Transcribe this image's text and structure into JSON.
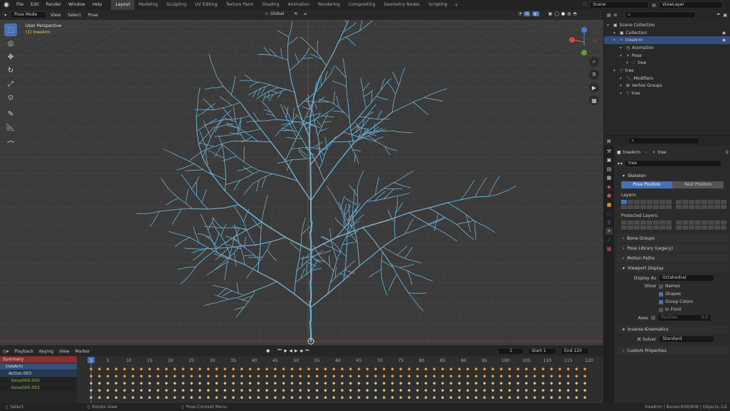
{
  "topbar": {
    "menu": [
      "File",
      "Edit",
      "Render",
      "Window",
      "Help"
    ],
    "workspaces": [
      "Layout",
      "Modeling",
      "Sculpting",
      "UV Editing",
      "Texture Paint",
      "Shading",
      "Animation",
      "Rendering",
      "Compositing",
      "Geometry Nodes",
      "Scripting"
    ],
    "active_workspace": "Layout",
    "scene": "Scene",
    "view_layer": "ViewLayer"
  },
  "viewport": {
    "mode": "Pose Mode",
    "menus": [
      "View",
      "Select",
      "Pose"
    ],
    "orientation": "Global",
    "perspective": "User Perspective",
    "object": "(1) treeArm"
  },
  "outliner": {
    "rows": [
      {
        "label": "Scene Collection",
        "indent": 0,
        "icon": "collection-icon"
      },
      {
        "label": "Collection",
        "indent": 1,
        "icon": "collection-icon"
      },
      {
        "label": "treeArm",
        "indent": 1,
        "icon": "armature-icon",
        "selected": true
      },
      {
        "label": "Animation",
        "indent": 2,
        "icon": "animation-icon"
      },
      {
        "label": "Pose",
        "indent": 2,
        "icon": "pose-icon"
      },
      {
        "label": "tree",
        "indent": 3,
        "icon": "bone-icon"
      },
      {
        "label": "tree",
        "indent": 1,
        "icon": "mesh-icon"
      },
      {
        "label": "Modifiers",
        "indent": 2,
        "icon": "wrench-icon"
      },
      {
        "label": "Vertex Groups",
        "indent": 2,
        "icon": "vertex-group-icon"
      },
      {
        "label": "tree",
        "indent": 2,
        "icon": "mesh-data-icon"
      }
    ]
  },
  "properties": {
    "breadcrumb_object": "treeArm",
    "breadcrumb_data": "tree",
    "data_name": "tree",
    "skeleton": "Skeleton",
    "pose_position": "Pose Position",
    "rest_position": "Rest Position",
    "layers": "Layers:",
    "protected_layers": "Protected Layers:",
    "bone_groups": "Bone Groups",
    "pose_library": "Pose Library (Legacy)",
    "motion_paths": "Motion Paths",
    "viewport_display": "Viewport Display",
    "display_as_label": "Display As",
    "display_as": "Octahedral",
    "show_label": "Show",
    "names": "Names",
    "shapes": "Shapes",
    "group_colors": "Group Colors",
    "in_front": "In Front",
    "axes": "Axes",
    "axes_position": "Position",
    "axes_value": "0.0",
    "inverse_kinematics": "Inverse Kinematics",
    "ik_solver_label": "IK Solver",
    "ik_solver": "Standard",
    "custom_properties": "Custom Properties"
  },
  "timeline": {
    "menus": [
      "Playback",
      "Keying",
      "View",
      "Marker"
    ],
    "current_frame": "1",
    "start_label": "Start",
    "start": "1",
    "end_label": "End",
    "end": "120",
    "ticks": [
      "1",
      "5",
      "10",
      "15",
      "20",
      "25",
      "30",
      "35",
      "40",
      "45",
      "50",
      "55",
      "60",
      "65",
      "70",
      "75",
      "80",
      "85",
      "90",
      "95",
      "100",
      "105",
      "110",
      "115",
      "120"
    ],
    "channels": [
      "Summary",
      "treeArm",
      "Action.003",
      "bone000.000",
      "bone000.003"
    ]
  },
  "statusbar": {
    "select": "Select",
    "rotate": "Rotate View",
    "context": "Pose Context Menu",
    "stats": "treeArm | Bones:608/608 | Objects:1/2"
  },
  "colors": {
    "accent": "#4772b3",
    "bone": "#5bb7e6",
    "keyframe": "#e8a23a"
  }
}
